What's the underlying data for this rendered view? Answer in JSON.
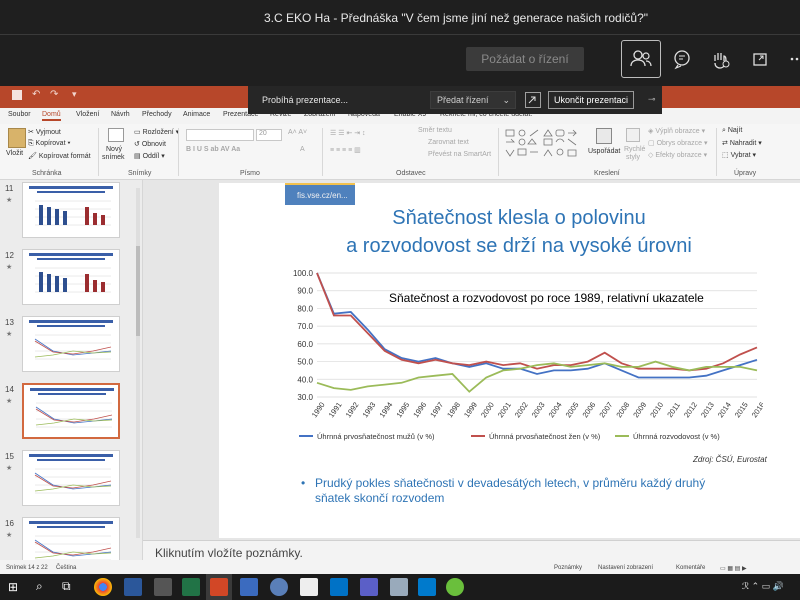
{
  "meeting": {
    "title": "3.C EKO Ha - Přednáška \"V čem jsme jiní než generace našich rodičů?\"",
    "request_control": "Požádat o řízení"
  },
  "presentation_bar": {
    "status": "Probíhá prezentace...",
    "give_control": "Předat řízení",
    "stop": "Ukončit prezentaci"
  },
  "ribbon": {
    "tabs": [
      "Soubor",
      "Domů",
      "Vložení",
      "Návrh",
      "Přechody",
      "Animace",
      "Prezentace",
      "Revize",
      "Zobrazení",
      "Nápověda",
      "Enable X9"
    ],
    "active_tab": "Domů",
    "tell_me": "Řekněte mi, co chcete udělat.",
    "clipboard": {
      "paste": "Vložit",
      "cut": "Vyjmout",
      "copy": "Kopírovat",
      "format": "Kopírovat formát",
      "group": "Schránka"
    },
    "slides": {
      "new": "Nový",
      "new2": "snímek",
      "layout": "Rozložení",
      "reset": "Obnovit",
      "section": "Oddíl",
      "group": "Snímky"
    },
    "font": {
      "size": "20",
      "group": "Písmo"
    },
    "paragraph": {
      "direction": "Směr textu",
      "align": "Zarovnat text",
      "smartart": "Převést na SmartArt",
      "group": "Odstavec"
    },
    "drawing": {
      "arrange": "Uspořádat",
      "quick": "Rychlé",
      "styles": "styly",
      "fill": "Výplň obrazce",
      "outline": "Obrys obrazce",
      "effects": "Efekty obrazce",
      "group": "Kreslení"
    },
    "editing": {
      "find": "Najít",
      "replace": "Nahradit",
      "select": "Vybrat",
      "group": "Úpravy"
    }
  },
  "thumbnails": [
    {
      "num": "11",
      "selected": false
    },
    {
      "num": "12",
      "selected": false
    },
    {
      "num": "13",
      "selected": false
    },
    {
      "num": "14",
      "selected": true
    },
    {
      "num": "15",
      "selected": false
    },
    {
      "num": "16",
      "selected": false
    }
  ],
  "slide": {
    "source_tag": "fis.vse.cz/en...",
    "title_line1": "Sňatečnost klesla o polovinu",
    "title_line2": "a rozvodovost se drží na vysoké úrovni",
    "bullet": "Prudký pokles sňatečnosti v devadesátých letech, v průměru každý druhý sňatek skončí rozvodem",
    "source": "Zdroj: ČSÚ, Eurostat"
  },
  "chart_data": {
    "type": "line",
    "title": "Sňatečnost a rozvodovost po roce 1989, relativní ukazatele",
    "x": [
      "1990",
      "1991",
      "1992",
      "1993",
      "1994",
      "1995",
      "1996",
      "1997",
      "1998",
      "1999",
      "2000",
      "2001",
      "2002",
      "2003",
      "2004",
      "2005",
      "2006",
      "2007",
      "2008",
      "2009",
      "2010",
      "2011",
      "2012",
      "2013",
      "2014",
      "2015",
      "2016"
    ],
    "ylim": [
      30,
      100
    ],
    "yticks": [
      "100.0",
      "90.0",
      "80.0",
      "70.0",
      "60.0",
      "50.0",
      "40.0",
      "30.0"
    ],
    "grid": "horizontal",
    "legend": "bottom",
    "series": [
      {
        "name": "Úhrnná prvosňatečnost mužů (v %)",
        "color": "#4472c4",
        "values": [
          100,
          77,
          78,
          68,
          57,
          52,
          50,
          52,
          49,
          47,
          49,
          46,
          46,
          43,
          45,
          45,
          46,
          49,
          45,
          41,
          41,
          41,
          41,
          42,
          45,
          48,
          51
        ]
      },
      {
        "name": "Úhrnná prvosňatečnost žen (v %)",
        "color": "#c0504d",
        "values": [
          100,
          76,
          76,
          66,
          56,
          51,
          49,
          51,
          49,
          48,
          50,
          48,
          49,
          46,
          48,
          48,
          50,
          55,
          49,
          46,
          46,
          46,
          45,
          46,
          49,
          54,
          58
        ]
      },
      {
        "name": "Úhrnná rozvodovost (v %)",
        "color": "#9bbb59",
        "values": [
          38,
          35,
          34,
          36,
          37,
          38,
          41,
          42,
          43,
          33,
          41,
          45,
          46,
          48,
          49,
          47,
          48,
          49,
          47,
          47,
          50,
          47,
          45,
          47,
          47,
          47,
          45
        ]
      }
    ]
  },
  "notes": {
    "placeholder": "Kliknutím vložíte poznámky."
  },
  "statusbar": {
    "slide": "Snímek 14 z 22",
    "language": "Čeština",
    "notes": "Poznámky",
    "display": "Nastavení zobrazení",
    "comments": "Komentáře"
  }
}
